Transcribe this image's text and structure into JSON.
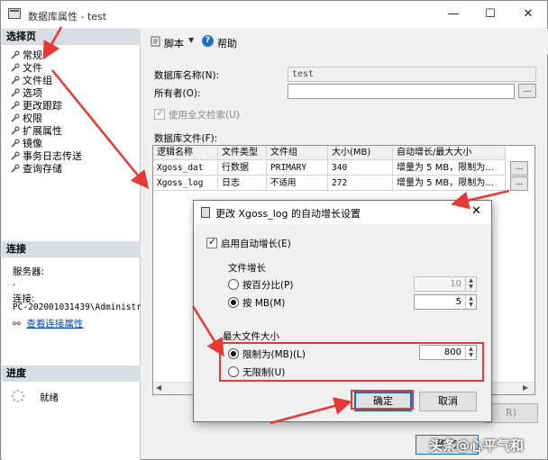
{
  "window": {
    "title": "数据库属性 - test",
    "minimize": "—",
    "maximize": "☐",
    "close": "✕"
  },
  "left": {
    "select_page_header": "选择页",
    "pages": [
      "常规",
      "文件",
      "文件组",
      "选项",
      "更改跟踪",
      "权限",
      "扩展属性",
      "镜像",
      "事务日志传送",
      "查询存储"
    ],
    "connection_header": "连接",
    "server_label": "服务器:",
    "server_value": ".",
    "connection_label": "连接:",
    "connection_value": "PC-202001031439\\Administrat",
    "view_connection_link": "查看连接属性",
    "progress_header": "进度",
    "progress_status": "就绪"
  },
  "toolbar": {
    "script_label": "脚本",
    "help_label": "帮助"
  },
  "form": {
    "db_name_label": "数据库名称(N):",
    "db_name_value": "test",
    "owner_label": "所有者(O):",
    "owner_value": "",
    "fulltext_label": "使用全文检索(U)",
    "db_files_label": "数据库文件(F):"
  },
  "grid": {
    "columns": [
      "逻辑名称",
      "文件类型",
      "文件组",
      "大小(MB)",
      "自动增长/最大大小"
    ],
    "rows": [
      [
        "Xgoss_dat",
        "行数据",
        "PRIMARY",
        "340",
        "增量为 5 MB，限制为..."
      ],
      [
        "Xgoss_log",
        "日志",
        "不适用",
        "272",
        "增量为 5 MB，限制为..."
      ]
    ],
    "ellipsis": "..."
  },
  "main_buttons": {
    "right_partial": "R)",
    "ok_partial": "确定"
  },
  "dialog": {
    "title": "更改 Xgoss_log 的自动增长设置",
    "close": "✕",
    "enable_autogrowth": "启用自动增长(E)",
    "file_growth_label": "文件增长",
    "by_percent_label": "按百分比(P)",
    "by_percent_value": "10",
    "by_mb_label": "按 MB(M)",
    "by_mb_value": "5",
    "max_size_label": "最大文件大小",
    "limited_label": "限制为(MB)(L)",
    "limited_value": "800",
    "unlimited_label": "无限制(U)",
    "ok": "确定",
    "cancel": "取消"
  },
  "watermark": "头条@心平气和",
  "colors": {
    "highlight": "#e53935",
    "link": "#0645ad",
    "accent": "#0078d7"
  }
}
